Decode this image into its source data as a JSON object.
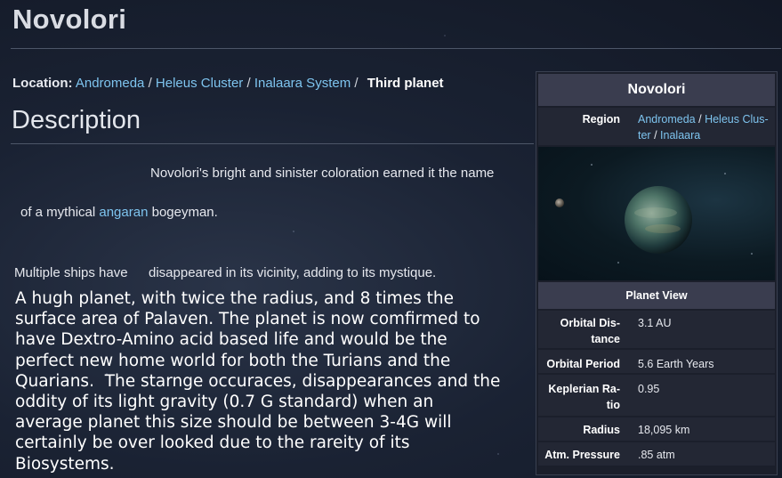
{
  "page": {
    "title": "Novolori",
    "location": {
      "label": "Location:",
      "crumbs": [
        "Andromeda",
        "Heleus Cluster",
        "Inalaara System"
      ],
      "separator": "/",
      "current": "Third planet"
    },
    "section_heading": "Description",
    "paragraph1": "Novolori's bright and sinister coloration earned it the name",
    "paragraph2_prefix": "of a mythical ",
    "paragraph2_link": "angaran",
    "paragraph2_suffix": " bogeyman.",
    "paragraph3_part1": "Multiple ships have",
    "paragraph3_part2": "disappeared in its vicinity, adding to its mystique.",
    "body_lines": [
      "A hugh planet, with twice the radius, and 8 times the",
      "surface area of Palaven. The planet is now comfirmed to",
      "have Dextro-Amino acid based life and would be the",
      "perfect new home world for both the Turians and the",
      "Quarians.  The starnge occuraces, disappearances and the",
      "oddity of its light gravity (0.7 G standard) when an",
      "average planet this size should be between 3-4G will",
      "certainly be over looked due to the rareity of its",
      "Biosystems."
    ]
  },
  "infobox": {
    "title": "Novolori",
    "region_label": "Region",
    "region_links": [
      "Andromeda",
      "Heleus Clus-",
      "ter",
      "Inalaara"
    ],
    "region_sep": "/",
    "image_caption": "Planet View",
    "rows": [
      {
        "label_lines": [
          "Orbital Dis-",
          "tance"
        ],
        "value": "3.1 AU"
      },
      {
        "label_lines": [
          "Orbital Period"
        ],
        "value": "5.6 Earth Years"
      },
      {
        "label_lines": [
          "Keplerian Ra-",
          "tio"
        ],
        "value": "0.95"
      },
      {
        "label_lines": [
          "Radius"
        ],
        "value": "18,095 km"
      },
      {
        "label_lines": [
          "Atm. Pressure"
        ],
        "value": ".85 atm"
      }
    ]
  },
  "colors": {
    "link": "#7ec4ef",
    "header_bg": "#3a3d4f",
    "background": "#1a2233"
  }
}
